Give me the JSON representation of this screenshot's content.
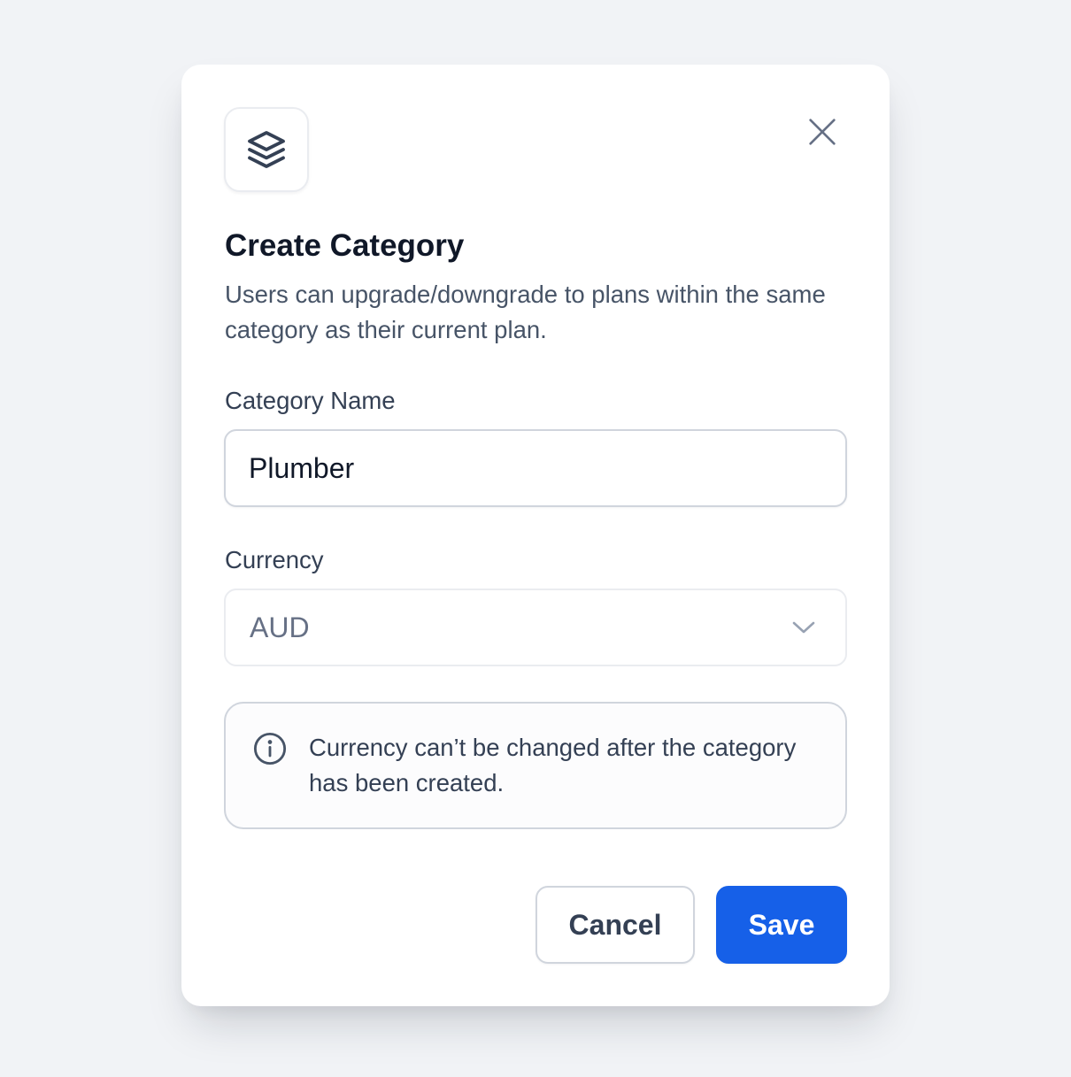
{
  "colors": {
    "background": "#f1f3f6",
    "accent": "#1660e8",
    "title": "#101828",
    "body_text": "#475467"
  },
  "modal": {
    "header_icon": "layers-icon",
    "close_icon": "close-icon",
    "title": "Create Category",
    "description": "Users can upgrade/downgrade to plans within the same category as their current plan."
  },
  "form": {
    "category_name": {
      "label": "Category Name",
      "value": "Plumber"
    },
    "currency": {
      "label": "Currency",
      "selected": "AUD",
      "icon": "chevron-down-icon"
    }
  },
  "notice": {
    "icon": "info-icon",
    "text": "Currency can’t be changed after the category has been created."
  },
  "actions": {
    "cancel_label": "Cancel",
    "save_label": "Save"
  }
}
